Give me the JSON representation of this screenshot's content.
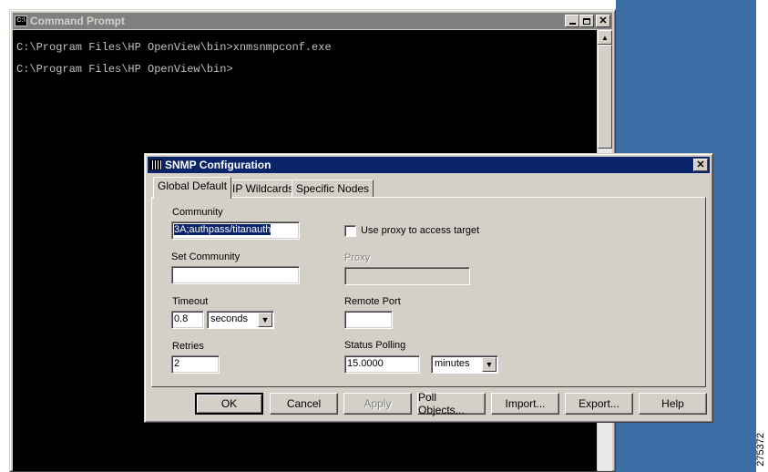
{
  "cmd_window": {
    "title": "Command Prompt",
    "icon": "cmd-icon",
    "lines": [
      "C:\\Program Files\\HP OpenView\\bin>xnmsnmpconf.exe",
      "C:\\Program Files\\HP OpenView\\bin>"
    ],
    "controls": {
      "minimize": "minimize-icon",
      "maximize": "maximize-icon",
      "close": "close-icon"
    }
  },
  "dialog": {
    "title": "SNMP Configuration",
    "icon": "snmp-config-icon",
    "close_icon": "close-icon",
    "tabs": [
      "Global Default",
      "IP Wildcards",
      "Specific Nodes"
    ],
    "selected_tab": "Global Default",
    "community": {
      "label": "Community",
      "value": "3A;authpass/titanauth"
    },
    "set_community": {
      "label": "Set Community",
      "value": ""
    },
    "timeout": {
      "label": "Timeout",
      "value": "0.8",
      "unit": "seconds"
    },
    "retries": {
      "label": "Retries",
      "value": "2"
    },
    "use_proxy": {
      "label": "Use proxy to access target",
      "checked": false
    },
    "proxy": {
      "label": "Proxy",
      "value": "",
      "disabled": true
    },
    "remote_port": {
      "label": "Remote Port",
      "value": ""
    },
    "status_polling": {
      "label": "Status Polling",
      "value": "15.0000",
      "unit": "minutes"
    },
    "buttons": {
      "ok": "OK",
      "cancel": "Cancel",
      "apply": "Apply",
      "poll_objects": "Poll Objects...",
      "import": "Import...",
      "export": "Export...",
      "help": "Help"
    }
  },
  "figure_id": "275372",
  "colors": {
    "desktop": "#3a6ea5",
    "active_title": "#0a246a",
    "inactive_title": "#808080",
    "face": "#d4d0c8"
  }
}
